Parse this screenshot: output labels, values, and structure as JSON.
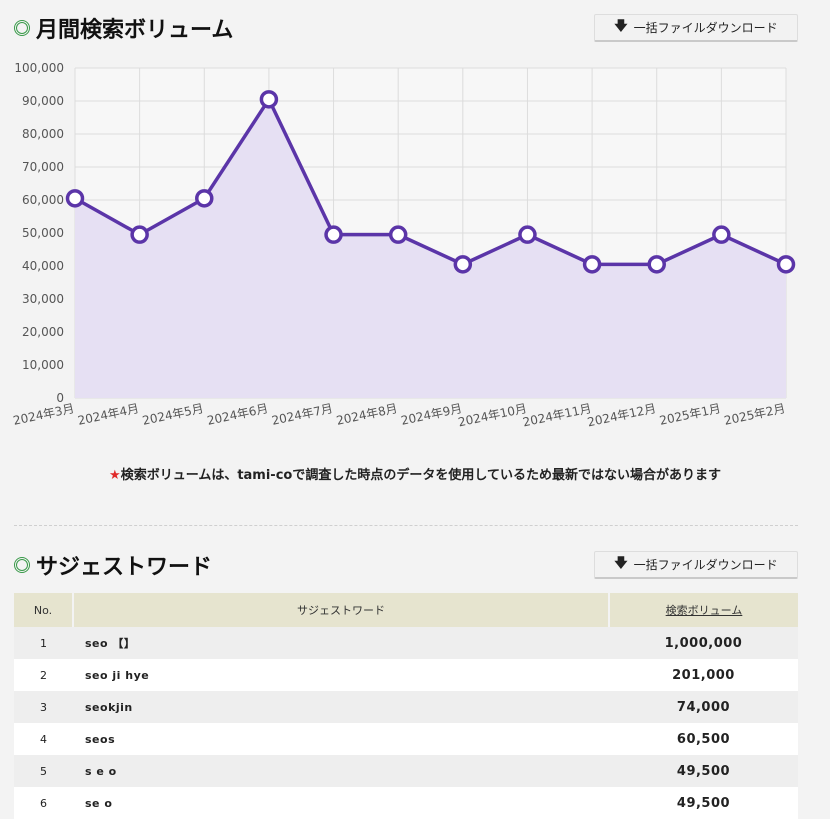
{
  "volume_section": {
    "title": "月間検索ボリューム",
    "download_label": "一括ファイルダウンロード",
    "note_star": "★",
    "note": "検索ボリュームは、tami-coで調査した時点のデータを使用しているため最新ではない場合があります"
  },
  "chart_data": {
    "type": "area",
    "title": "",
    "xlabel": "",
    "ylabel": "",
    "categories": [
      "2024年3月",
      "2024年4月",
      "2024年5月",
      "2024年6月",
      "2024年7月",
      "2024年8月",
      "2024年9月",
      "2024年10月",
      "2024年11月",
      "2024年12月",
      "2025年1月",
      "2025年2月"
    ],
    "values": [
      60500,
      49500,
      60500,
      90500,
      49500,
      49500,
      40500,
      49500,
      40500,
      40500,
      49500,
      40500
    ],
    "ylim": [
      0,
      100000
    ],
    "yticks": [
      "0",
      "10,000",
      "20,000",
      "30,000",
      "40,000",
      "50,000",
      "60,000",
      "70,000",
      "80,000",
      "90,000",
      "100,000"
    ],
    "grid": true,
    "line_color": "#5b35a8",
    "fill_color": "#e6e0f3"
  },
  "suggest_section": {
    "title": "サジェストワード",
    "download_label": "一括ファイルダウンロード",
    "columns": [
      "No.",
      "サジェストワード",
      "検索ボリューム"
    ],
    "rows": [
      {
        "no": "1",
        "keyword": "seo 【】",
        "volume": "1,000,000"
      },
      {
        "no": "2",
        "keyword": "seo ji hye",
        "volume": "201,000"
      },
      {
        "no": "3",
        "keyword": "seokjin",
        "volume": "74,000"
      },
      {
        "no": "4",
        "keyword": "seos",
        "volume": "60,500"
      },
      {
        "no": "5",
        "keyword": "s e o",
        "volume": "49,500"
      },
      {
        "no": "6",
        "keyword": "se o",
        "volume": "49,500"
      }
    ]
  }
}
